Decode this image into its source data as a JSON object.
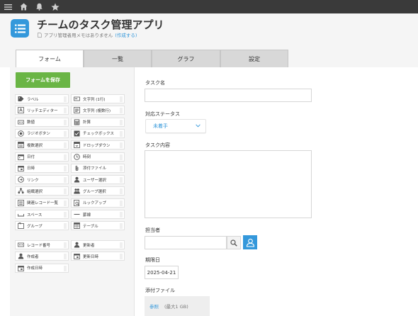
{
  "topbar": {
    "icons": [
      "menu-icon",
      "home-icon",
      "bell-icon",
      "star-icon"
    ]
  },
  "app": {
    "title": "チームのタスク管理アプリ",
    "memo_text": "アプリ管理者用メモはありません",
    "memo_link": "(作成する)",
    "icon_color": "#3498db"
  },
  "tabs": [
    {
      "label": "フォーム",
      "active": true
    },
    {
      "label": "一覧",
      "active": false
    },
    {
      "label": "グラフ",
      "active": false
    },
    {
      "label": "設定",
      "active": false
    }
  ],
  "palette": {
    "save_label": "フォームを保存",
    "save_color": "#6ab545",
    "items": [
      {
        "label": "ラベル",
        "icon": "label-icon"
      },
      {
        "label": "文字列 (1行)",
        "icon": "single-line-text-icon"
      },
      {
        "label": "リッチエディター",
        "icon": "rich-editor-icon"
      },
      {
        "label": "文字列 (複数行)",
        "icon": "multi-line-text-icon"
      },
      {
        "label": "数値",
        "icon": "number-icon"
      },
      {
        "label": "計算",
        "icon": "calculator-icon"
      },
      {
        "label": "ラジオボタン",
        "icon": "radio-button-icon"
      },
      {
        "label": "チェックボックス",
        "icon": "checkbox-icon"
      },
      {
        "label": "複数選択",
        "icon": "multi-select-icon"
      },
      {
        "label": "ドロップダウン",
        "icon": "dropdown-icon"
      },
      {
        "label": "日付",
        "icon": "calendar-icon"
      },
      {
        "label": "時刻",
        "icon": "clock-icon"
      },
      {
        "label": "日時",
        "icon": "datetime-icon"
      },
      {
        "label": "添付ファイル",
        "icon": "paperclip-icon"
      },
      {
        "label": "リンク",
        "icon": "link-icon"
      },
      {
        "label": "ユーザー選択",
        "icon": "user-icon"
      },
      {
        "label": "組織選択",
        "icon": "organization-icon"
      },
      {
        "label": "グループ選択",
        "icon": "group-icon"
      },
      {
        "label": "関連レコード一覧",
        "icon": "related-records-icon"
      },
      {
        "label": "ルックアップ",
        "icon": "lookup-icon"
      },
      {
        "label": "スペース",
        "icon": "space-icon"
      },
      {
        "label": "罫線",
        "icon": "border-line-icon"
      },
      {
        "label": "グループ",
        "icon": "group-box-icon"
      },
      {
        "label": "テーブル",
        "icon": "table-icon"
      }
    ],
    "system_items": [
      {
        "label": "レコード番号",
        "icon": "record-number-icon"
      },
      {
        "label": "作成者",
        "icon": "creator-icon"
      },
      {
        "label": "作成日時",
        "icon": "created-datetime-icon"
      },
      {
        "label": "更新者",
        "icon": "updater-icon"
      },
      {
        "label": "更新日時",
        "icon": "updated-datetime-icon"
      }
    ]
  },
  "form": {
    "task_name_label": "タスク名",
    "status_label": "対応ステータス",
    "status_value": "未着手",
    "description_label": "タスク内容",
    "assignee_label": "担当者",
    "due_date_label": "期限日",
    "due_date_value": "2025-04-21",
    "attachment_label": "添付ファイル",
    "browse_label": "参照",
    "size_limit": "(最大1 GB)"
  }
}
